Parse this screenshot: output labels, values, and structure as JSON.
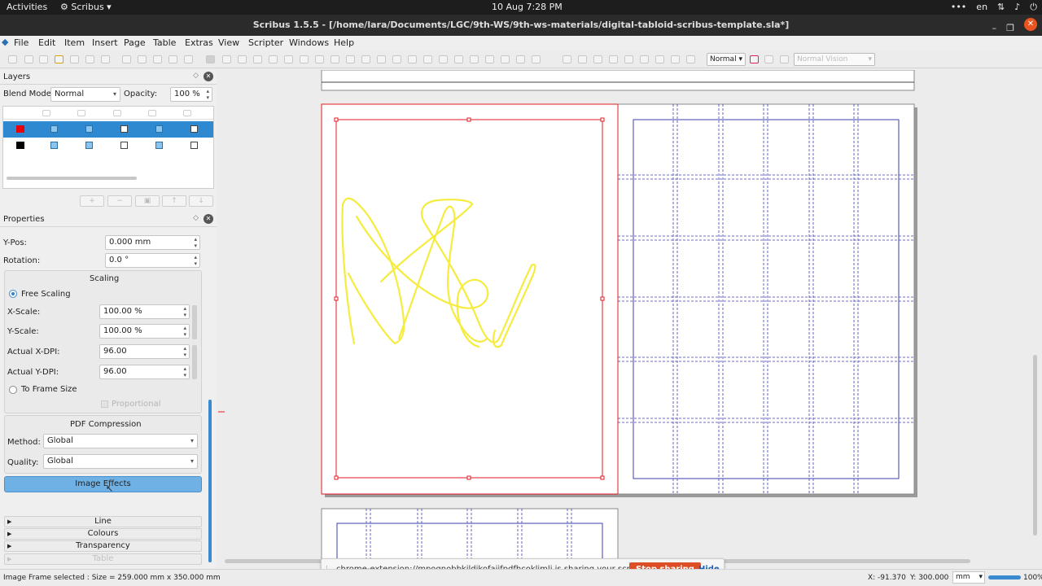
{
  "system_bar": {
    "activities": "Activities",
    "app_name": "Scribus",
    "clock": "10 Aug  7:28 PM",
    "lang": "en"
  },
  "window": {
    "title": "Scribus 1.5.5 - [/home/lara/Documents/LGC/9th-WS/9th-ws-materials/digital-tabloid-scribus-template.sla*]"
  },
  "menu": [
    "File",
    "Edit",
    "Item",
    "Insert",
    "Page",
    "Table",
    "Extras",
    "View",
    "Scripter",
    "Windows",
    "Help"
  ],
  "toolbar": {
    "preview_mode": "Normal",
    "vision_mode": "Normal Vision"
  },
  "layers": {
    "title": "Layers",
    "blend_label": "Blend Mode:",
    "blend_value": "Normal",
    "opacity_label": "Opacity:",
    "opacity_value": "100 %",
    "rows": [
      {
        "color": "#e8000b",
        "selected": true,
        "flags": [
          true,
          true,
          false,
          true,
          false
        ]
      },
      {
        "color": "#000000",
        "selected": false,
        "flags": [
          true,
          true,
          false,
          true,
          false
        ]
      }
    ],
    "buttons": [
      "+",
      "−",
      "▣",
      "↑",
      "↓"
    ]
  },
  "properties": {
    "title": "Properties",
    "ypos_label": "Y-Pos:",
    "ypos_value": "0.000 mm",
    "rotation_label": "Rotation:",
    "rotation_value": "0.0 °",
    "scaling": {
      "title": "Scaling",
      "free": "Free Scaling",
      "xscale_label": "X-Scale:",
      "xscale_value": "100.00 %",
      "yscale_label": "Y-Scale:",
      "yscale_value": "100.00 %",
      "xdpi_label": "Actual X-DPI:",
      "xdpi_value": "96.00",
      "ydpi_label": "Actual Y-DPI:",
      "ydpi_value": "96.00",
      "to_frame": "To Frame Size",
      "proportional": "Proportional"
    },
    "pdf": {
      "title": "PDF Compression",
      "method_label": "Method:",
      "method_value": "Global",
      "quality_label": "Quality:",
      "quality_value": "Global"
    },
    "image_effects": "Image Effects",
    "sections": [
      "Line",
      "Colours",
      "Transparency",
      "Table"
    ]
  },
  "notification": {
    "text": "chrome-extension://mpognobbkildjkofajifpdfhcoklimli is sharing your screen.",
    "stop": "Stop sharing",
    "hide": "Hide"
  },
  "status": {
    "message": "Image Frame selected : Size = 259.000 mm x 350.000 mm",
    "x": "X: -91.370",
    "y": "Y: 300.000",
    "unit": "mm",
    "zoom": "100%"
  },
  "colors": {
    "selection": "#2f89d1",
    "accent": "#e95420",
    "margin": "#e31b23",
    "guide": "#3f3fb0",
    "scribble": "#f5ec3f"
  }
}
